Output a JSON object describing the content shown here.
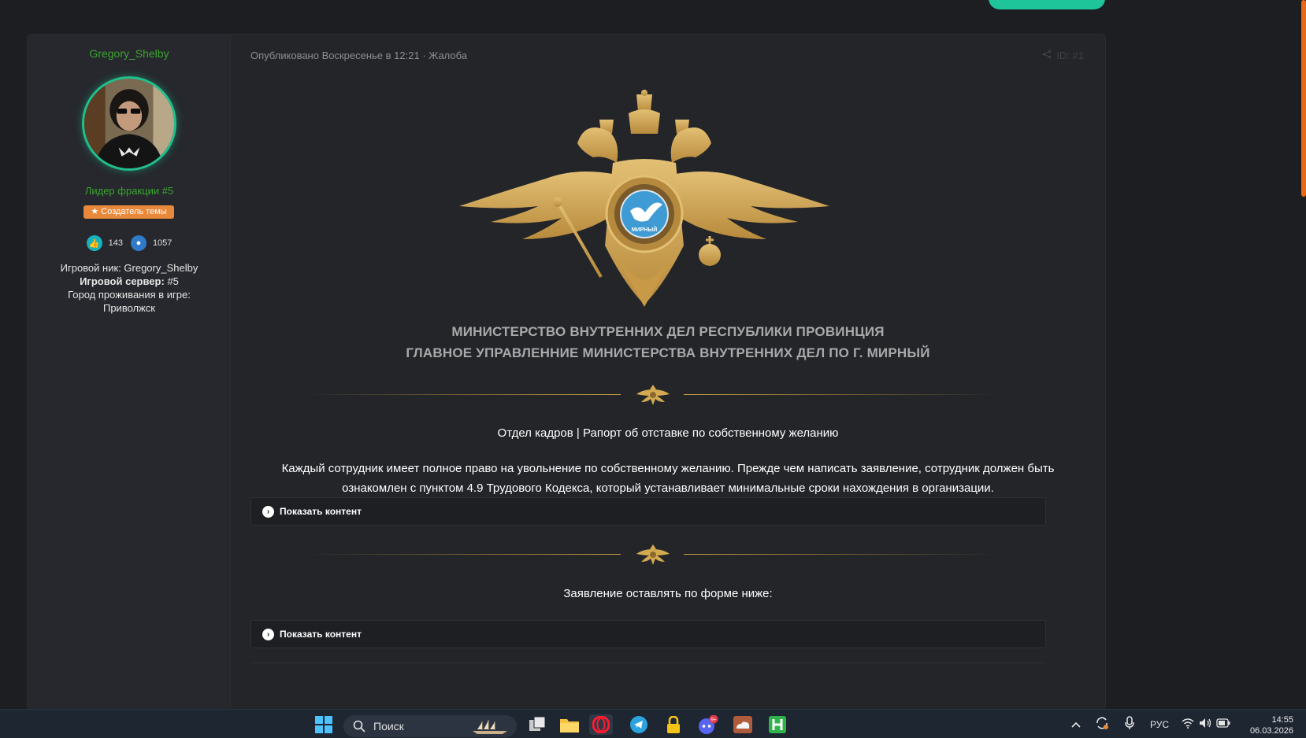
{
  "author": {
    "username": "Gregory_Shelby",
    "title": "Лидер фракции #5",
    "badge_label": "Создатель темы",
    "likes": "143",
    "messages": "1057",
    "game_nick_label": "Игровой ник:",
    "game_nick": "Gregory_Shelby",
    "server_label": "Игровой сервер:",
    "server": "#5",
    "city_label": "Город проживания в игре:",
    "city": "Приволжск"
  },
  "post": {
    "published": "Опубликовано Воскресенье в 12:21",
    "separator": "·",
    "report": "Жалоба",
    "post_id": "ID: #1",
    "emblem_text": "МИРНЫЙ",
    "title_line1": "МИНИСТЕРСТВО ВНУТРЕННИХ ДЕЛ РЕСПУБЛИКИ ПРОВИНЦИЯ",
    "title_line2": "ГЛАВНОЕ УПРАВЛЕННИЕ МИНИСТЕРСТВА ВНУТРЕННИХ ДЕЛ ПО Г. МИРНЫЙ",
    "subtitle": "Отдел кадров | Рапорт об отставке по собственному желанию",
    "paragraph_line1": "Каждый сотрудник имеет полное право на увольнение по собственному желанию. Прежде чем написать заявление, сотрудник должен быть",
    "paragraph_line2": "ознакомлен с пунктом 4.9 Трудового Кодекса, который устанавливает минимальные сроки нахождения в организации.",
    "spoiler1_label": "Показать контент",
    "form_note": "Заявление оставлять по форме ниже:",
    "spoiler2_label": "Показать контент"
  },
  "taskbar": {
    "search_placeholder": "Поиск",
    "discord_badge": "9+",
    "language": "РУС",
    "time": "14:55",
    "date": "06.03.2026"
  },
  "colors": {
    "accent_green": "#3ba52f",
    "teal": "#1ec49a",
    "badge_orange": "#e8883a",
    "gold": "#c9a142",
    "background": "#1c1e22"
  }
}
